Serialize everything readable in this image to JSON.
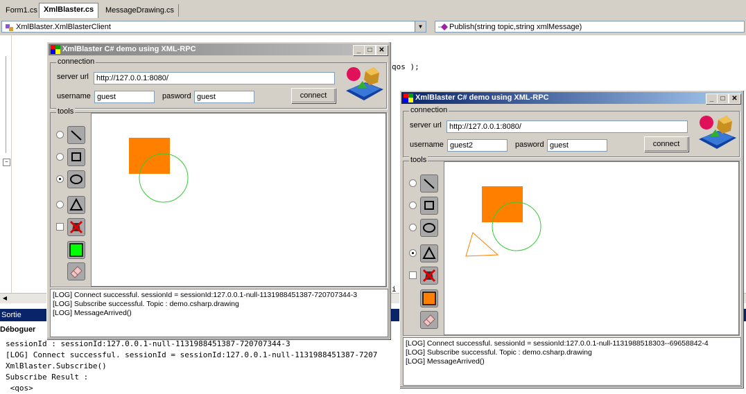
{
  "ide": {
    "tabs": [
      {
        "label": "Form1.cs",
        "active": false
      },
      {
        "label": "XmlBlaster.cs",
        "active": true
      },
      {
        "label": "MessageDrawing.cs",
        "active": false
      }
    ],
    "class_combo": "XmlBlaster.XmlBlasterClient",
    "method_combo": "Publish(string topic,string xmlMessage)",
    "code_fragment_1": "qos );",
    "code_fragment_2": "i",
    "sortie_label": "Sortie",
    "debug_label": "Déboguer",
    "output_lines": [
      "sessionId : sessionId:127.0.0.1-null-1131988451387-720707344-3",
      "[LOG] Connect successful. sessionId = sessionId:127.0.0.1-null-1131988451387-7207",
      "XmlBlaster.Subscribe()",
      "Subscribe Result :",
      " <qos>"
    ]
  },
  "windows": [
    {
      "title": "XmlBlaster C# demo using XML-RPC",
      "connection_label": "connection",
      "server_url_label": "server url",
      "server_url": "http://127.0.0.1:8080/",
      "username_label": "username",
      "username": "guest",
      "password_label": "pasword",
      "password": "guest",
      "connect_label": "connect",
      "tools_label": "tools",
      "selected_tool": "ellipse",
      "color": "#00ff00",
      "log_lines": [
        "[LOG] Connect successful. sessionId = sessionId:127.0.0.1-null-1131988451387-720707344-3",
        "[LOG] Subscribe successful. Topic : demo.csharp.drawing",
        "[LOG] MessageArrived()"
      ]
    },
    {
      "title": "XmlBlaster C# demo using XML-RPC",
      "connection_label": "connection",
      "server_url_label": "server url",
      "server_url": "http://127.0.0.1:8080/",
      "username_label": "username",
      "username": "guest2",
      "password_label": "pasword",
      "password": "guest",
      "connect_label": "connect",
      "tools_label": "tools",
      "selected_tool": "triangle",
      "color": "#ff8000",
      "log_lines": [
        "[LOG] Connect successful. sessionId = sessionId:127.0.0.1-null-1131988518303--69658842-4",
        "[LOG] Subscribe successful. Topic : demo.csharp.drawing",
        "[LOG] MessageArrived()"
      ]
    }
  ],
  "colors": {
    "shape_fill": "#ff8000",
    "circle_stroke": "#33cc33",
    "triangle_stroke": "#ff8000",
    "active_title": "#0a246a",
    "inactive_title": "#808080"
  },
  "icons": [
    "line-tool-icon",
    "rectangle-tool-icon",
    "ellipse-tool-icon",
    "triangle-tool-icon",
    "no-fill-icon",
    "color-swatch-icon",
    "eraser-icon",
    "xmlblaster-logo-icon",
    "minimize-icon",
    "maximize-icon",
    "close-icon"
  ]
}
